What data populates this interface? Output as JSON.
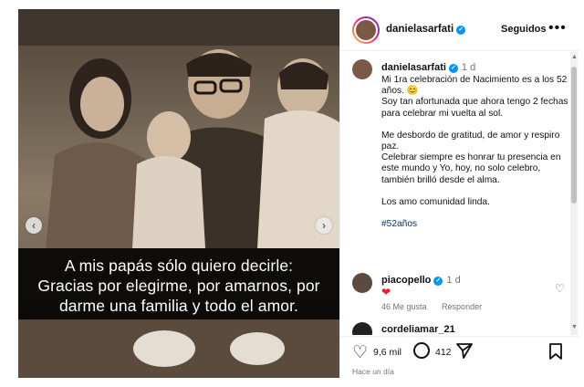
{
  "post": {
    "author": "danielasarfati",
    "follow_state": "Seguidos",
    "image_caption_lines": [
      "A mis papás sólo quiero decirle:",
      "Gracias por elegirme, por amarnos, por",
      "darme una familia y todo el amor."
    ],
    "caption": {
      "author": "danielasarfati",
      "time": "1 d",
      "paragraphs": [
        "Mi 1ra celebración de Nacimiento es a los  52 años. 😊",
        "Soy tan afortunada que ahora tengo 2 fechas para celebrar mi vuelta al sol.",
        "",
        "Me desbordo de gratitud, de amor y respiro paz.",
        "Celebrar siempre es honrar tu presencia en este mundo y Yo, hoy, no solo celebro, también brilló desde el alma.",
        "",
        "Los amo comunidad linda.",
        "",
        "#52años"
      ]
    },
    "comments": [
      {
        "user": "piacopello",
        "time": "1 d",
        "text": "❤",
        "likes_label": "46 Me gusta",
        "reply_label": "Responder"
      },
      {
        "user": "cordeliamar_21",
        "time": ""
      }
    ],
    "likes": "9,6 mil",
    "comments_count": "412",
    "time_ago": "Hace un día"
  },
  "icons": {
    "prev": "chevron-left-icon",
    "next": "chevron-right-icon",
    "more": "more-icon",
    "like": "heart-icon",
    "comment": "comment-icon",
    "share": "share-icon",
    "save": "bookmark-icon"
  },
  "colors": {
    "verified": "#0095f6",
    "heart": "#ed1c24",
    "hashtag": "#00376b"
  }
}
